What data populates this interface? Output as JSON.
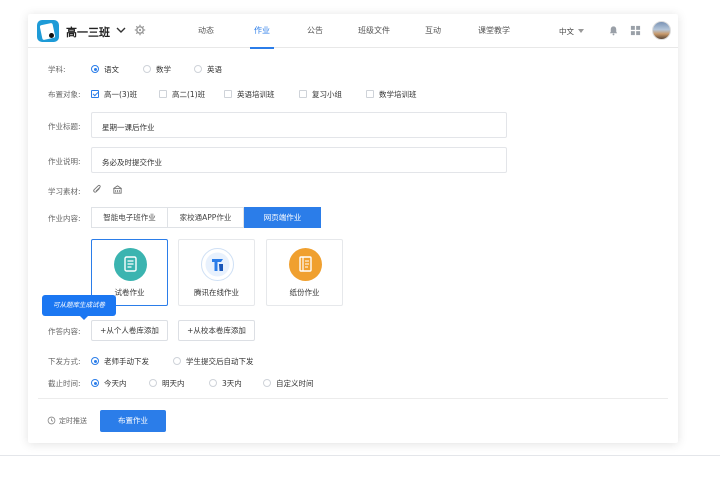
{
  "header": {
    "class_name": "高一三班",
    "nav": [
      "动态",
      "作业",
      "公告",
      "班级文件",
      "互动",
      "课堂教学"
    ],
    "active_nav": "作业",
    "language": "中文"
  },
  "form": {
    "subject": {
      "label": "学科:",
      "options": [
        "语文",
        "数学",
        "英语"
      ],
      "selected": "语文"
    },
    "target": {
      "label": "布置对象:",
      "options": [
        "高一(3)班",
        "高二(1)班",
        "英语培训班",
        "复习小组",
        "数学培训班"
      ],
      "checked": [
        "高一(3)班"
      ]
    },
    "title": {
      "label": "作业标题:",
      "value": "星期一课后作业"
    },
    "description": {
      "label": "作业说明:",
      "value": "务必及时提交作业"
    },
    "materials": {
      "label": "学习素材:"
    },
    "content": {
      "label": "作业内容:",
      "tabs": [
        "智能电子班作业",
        "家校通APP作业",
        "网页端作业"
      ],
      "active_tab": "网页端作业",
      "types": [
        "试卷作业",
        "腾讯在线作业",
        "纸份作业"
      ],
      "selected_type": "试卷作业"
    },
    "answer_content": {
      "label": "作答内容:",
      "tooltip": "可从题库生成试卷",
      "buttons": [
        "+从个人卷库添加",
        "+从校本卷库添加"
      ]
    },
    "dispatch": {
      "label": "下发方式:",
      "options": [
        "老师手动下发",
        "学生提交后自动下发"
      ],
      "selected": "老师手动下发"
    },
    "deadline": {
      "label": "截止时间:",
      "options": [
        "今天内",
        "明天内",
        "3天内",
        "自定义时间"
      ],
      "selected": "今天内"
    }
  },
  "footer": {
    "schedule_label": "定时推送",
    "publish_label": "布置作业"
  },
  "colors": {
    "accent": "#2b7de9",
    "tooltip": "#1b77f2",
    "teal": "#3bb4b0",
    "blue": "#2b7de9",
    "orange": "#f0a02f"
  }
}
